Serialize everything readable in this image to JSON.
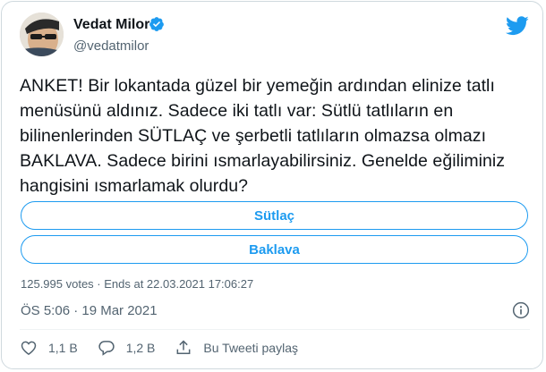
{
  "author": {
    "name": "Vedat Milor",
    "handle": "@vedatmilor"
  },
  "tweet": {
    "line1": "ANKET! Bir lokantada güzel bir yemeğin ardından elinize tatlı",
    "line2": "menüsünü aldınız. Sadece iki tatlı var: Sütlü tatlıların en",
    "line3": "bilinenlerinden SÜTLAÇ ve şerbetli tatlıların olmazsa olmazı",
    "line4": "BAKLAVA. Sadece birini ısmarlayabilirsiniz. Genelde eğiliminiz",
    "line5": "hangisini ısmarlamak olurdu?"
  },
  "poll": {
    "options": [
      {
        "label": "Sütlaç"
      },
      {
        "label": "Baklava"
      }
    ],
    "meta": "125.995 votes · Ends at 22.03.2021 17:06:27"
  },
  "timestamp": "ÖS 5:06 · 19 Mar 2021",
  "actions": {
    "likes": "1,1 B",
    "replies": "1,2 B",
    "share": "Bu Tweeti paylaş"
  },
  "icons": {
    "verified": "verified-badge-icon",
    "bird": "twitter-bird-icon",
    "info": "info-icon",
    "heart": "heart-icon",
    "reply": "reply-bubble-icon",
    "share": "share-icon"
  },
  "colors": {
    "accent": "#1d9bf0",
    "text": "#0f1419",
    "muted": "#536471",
    "border": "#cfd9de"
  }
}
